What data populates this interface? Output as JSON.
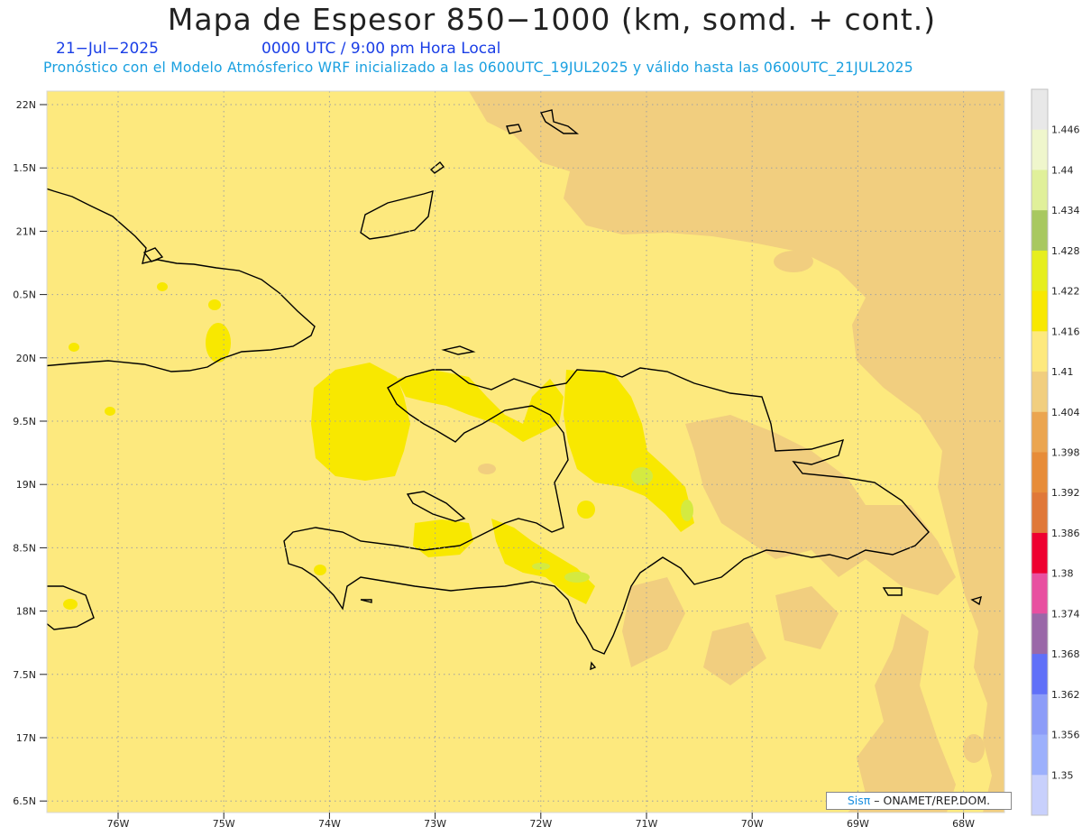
{
  "header": {
    "title": "Mapa de Espesor 850−1000 (km, somd. + cont.)",
    "date": "21−Jul−2025",
    "time": "0000 UTC / 9:00 pm Hora Local",
    "subtitle": "Pronóstico con el Modelo Atmósferico WRF inicializado a las 0600UTC_19JUL2025 y válido hasta las  0600UTC_21JUL2025"
  },
  "axes": {
    "lat_labels": [
      "22N",
      "1.5N",
      "21N",
      "0.5N",
      "20N",
      "9.5N",
      "19N",
      "8.5N",
      "18N",
      "7.5N",
      "17N",
      "6.5N"
    ],
    "lon_labels": [
      "76W",
      "75W",
      "74W",
      "73W",
      "72W",
      "71W",
      "70W",
      "69W",
      "68W"
    ]
  },
  "colorbar": {
    "labels": [
      "1.446",
      "1.44",
      "1.434",
      "1.428",
      "1.422",
      "1.416",
      "1.41",
      "1.404",
      "1.398",
      "1.392",
      "1.386",
      "1.38",
      "1.374",
      "1.368",
      "1.362",
      "1.356",
      "1.35"
    ],
    "colors": [
      "#e8e8e8",
      "#eff6cc",
      "#e0f09a",
      "#a8c860",
      "#e6ee1e",
      "#f8e800",
      "#fde97e",
      "#f1ce7f",
      "#eba550",
      "#e78c38",
      "#e07838",
      "#ee0030",
      "#e850a0",
      "#9a68a8",
      "#6070f8",
      "#8c9cf8",
      "#9cb0fc",
      "#c8d0fc"
    ]
  },
  "map": {
    "fill_base": "#fde97e",
    "fill_low": "#f1ce7f",
    "fill_high": "#f8e800",
    "fill_higher": "#e0f09a",
    "fill_highest": "#d4ea40"
  },
  "credit": {
    "brand": "Sisπ",
    "org": " – ONAMET/REP.DOM."
  }
}
